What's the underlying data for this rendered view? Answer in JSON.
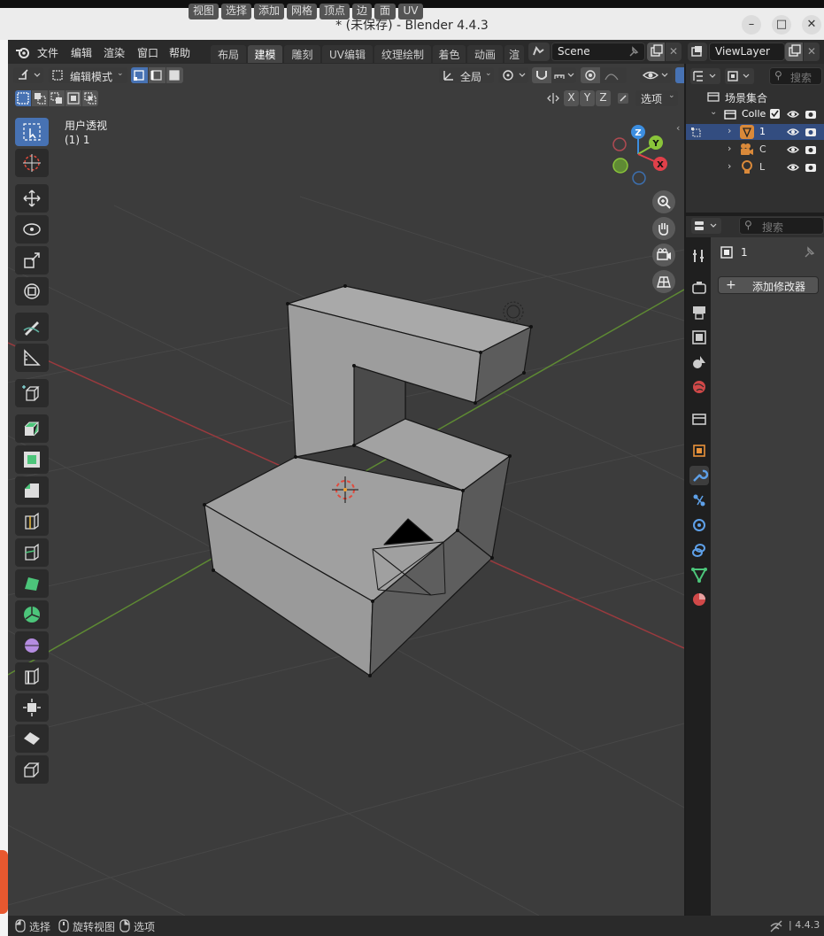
{
  "window": {
    "title": "* (未保存) - Blender 4.4.3"
  },
  "menu": {
    "items": [
      "文件",
      "编辑",
      "渲染",
      "窗口",
      "帮助"
    ]
  },
  "workspace_tabs": [
    {
      "label": "布局",
      "active": false
    },
    {
      "label": "建模",
      "active": true
    },
    {
      "label": "雕刻",
      "active": false
    },
    {
      "label": "UV编辑",
      "active": false
    },
    {
      "label": "纹理绘制",
      "active": false
    },
    {
      "label": "着色",
      "active": false
    },
    {
      "label": "动画",
      "active": false
    },
    {
      "label": "渲",
      "active": false
    }
  ],
  "scene": {
    "name": "Scene",
    "view_layer": "ViewLayer"
  },
  "viewport_header": {
    "mode": "编辑模式",
    "menus": [
      "视图",
      "选择",
      "添加",
      "网格",
      "顶点",
      "边",
      "面",
      "UV"
    ],
    "transform_orientation": "全局",
    "axes": [
      "X",
      "Y",
      "Z"
    ],
    "options_label": "选项"
  },
  "viewport": {
    "view_name": "用户透视",
    "object_label": "(1) 1",
    "gizmo_axes": {
      "z": "Z",
      "y": "Y",
      "x": "X"
    },
    "colors": {
      "x_axis": "#e0404a",
      "y_axis": "#8ac43a",
      "z_axis": "#3c8ee0",
      "background": "#3c3c3c",
      "selection": "#4772b3"
    }
  },
  "outliner": {
    "search_placeholder": "搜索",
    "root": "场景集合",
    "collection": "Colle",
    "items": [
      {
        "label": "1",
        "type": "mesh",
        "selected": true
      },
      {
        "label": "C",
        "type": "camera",
        "selected": false
      },
      {
        "label": "L",
        "type": "light",
        "selected": false
      }
    ]
  },
  "properties": {
    "search_placeholder": "搜索",
    "object_name": "1",
    "add_modifier_label": "添加修改器"
  },
  "statusbar": {
    "select": "选择",
    "rotate_view": "旋转视图",
    "options": "选项",
    "version": "4.4.3"
  }
}
